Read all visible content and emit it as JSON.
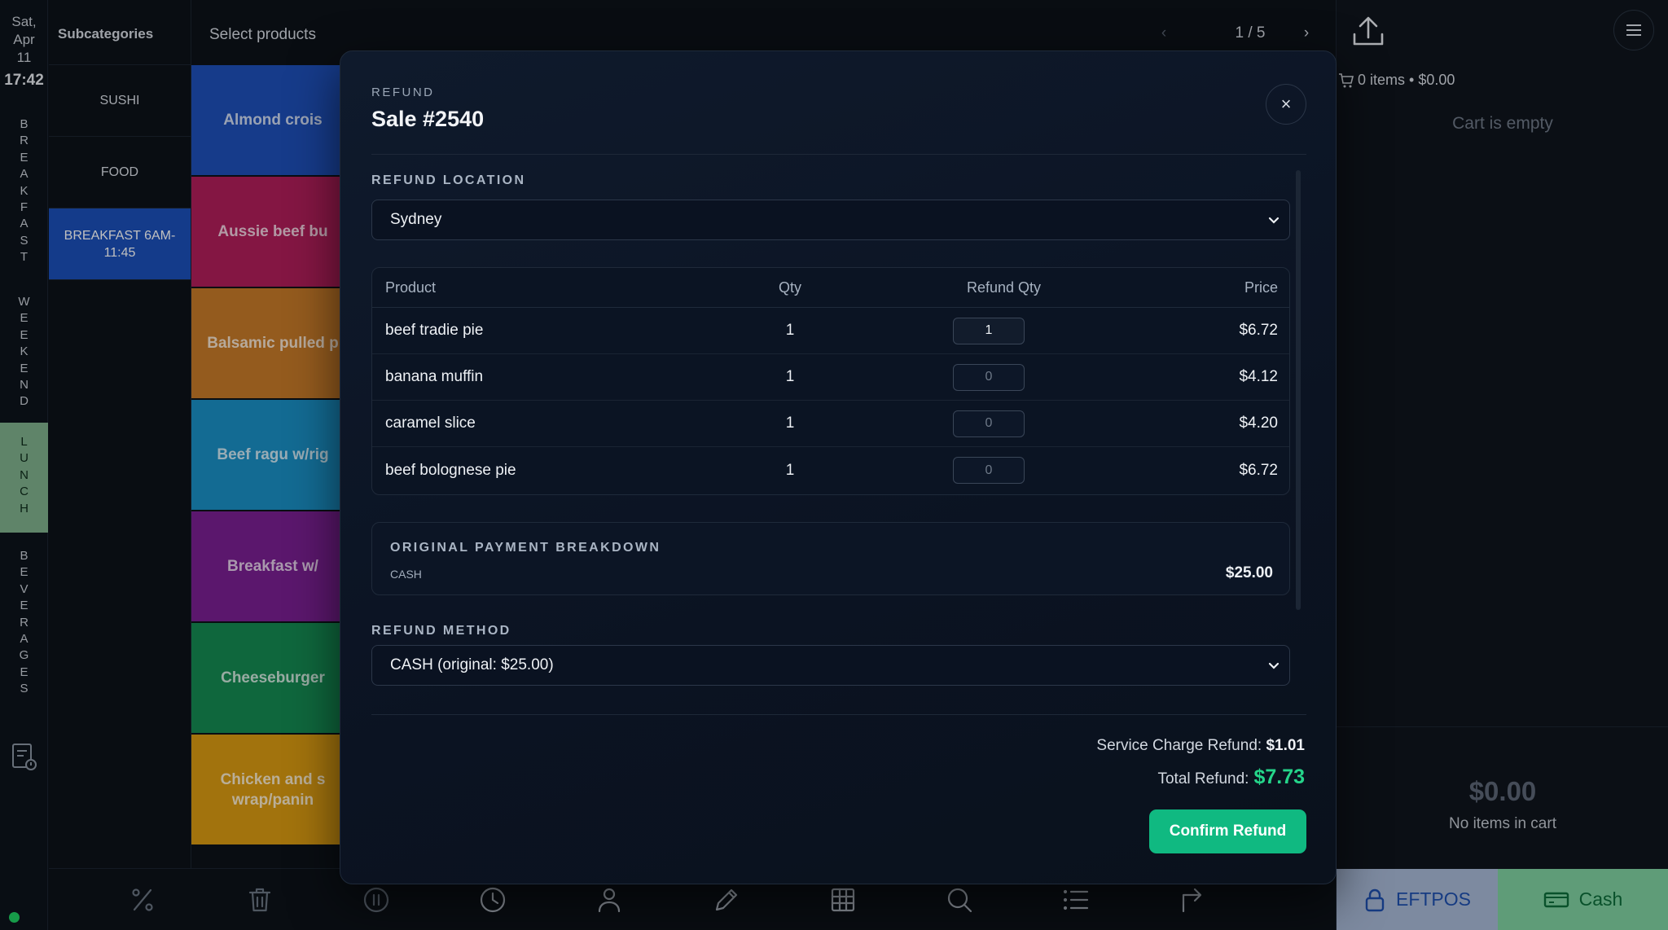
{
  "clock": {
    "date": "Sat,\nApr\n11",
    "time": "17:42"
  },
  "categories": [
    {
      "label": "BREAKFAST",
      "active": false
    },
    {
      "label": "WEEKEND",
      "active": false
    },
    {
      "label": "LUNCH",
      "active": true
    },
    {
      "label": "BEVERAGES",
      "active": false
    }
  ],
  "subcategories": {
    "title": "Subcategories",
    "items": [
      {
        "label": "SUSHI",
        "active": false
      },
      {
        "label": "FOOD",
        "active": false
      },
      {
        "label": "BREAKFAST 6AM-11:45",
        "active": true
      }
    ]
  },
  "products": {
    "title": "Select products",
    "pager": {
      "prev": "‹",
      "page": "1 / 5",
      "next": "›"
    },
    "tiles": [
      {
        "label": "Almond crois",
        "color": "#1e4fb8"
      },
      {
        "label": "Aussie beef bu",
        "color": "#b01e5a"
      },
      {
        "label": "Balsamic pulled p",
        "color": "#c67a28"
      },
      {
        "label": "Beef ragu w/rig",
        "color": "#1a8fc4"
      },
      {
        "label": "Breakfast w/",
        "color": "#7a1f92"
      },
      {
        "label": "Cheeseburger",
        "color": "#148a52"
      },
      {
        "label": "Chicken and s wrap/panin",
        "color": "#d99a12"
      }
    ]
  },
  "cart": {
    "summary": "0 items • $0.00",
    "empty_text": "Cart is empty",
    "total": "$0.00",
    "no_items": "No items in cart",
    "eftpos_label": "EFTPOS",
    "cash_label": "Cash"
  },
  "modal": {
    "kicker": "REFUND",
    "title": "Sale #2540",
    "close": "×",
    "location_label": "REFUND LOCATION",
    "location_value": "Sydney",
    "table": {
      "headers": {
        "product": "Product",
        "qty": "Qty",
        "refund_qty": "Refund Qty",
        "price": "Price"
      },
      "rows": [
        {
          "product": "beef tradie pie",
          "qty": "1",
          "refund_qty": "1",
          "price": "$6.72"
        },
        {
          "product": "banana muffin",
          "qty": "1",
          "refund_qty": "0",
          "price": "$4.12"
        },
        {
          "product": "caramel slice",
          "qty": "1",
          "refund_qty": "0",
          "price": "$4.20"
        },
        {
          "product": "beef bolognese pie",
          "qty": "1",
          "refund_qty": "0",
          "price": "$6.72"
        }
      ]
    },
    "payment": {
      "title": "ORIGINAL PAYMENT BREAKDOWN",
      "method": "CASH",
      "amount": "$25.00"
    },
    "method_label": "REFUND METHOD",
    "method_value": "CASH (original: $25.00)",
    "service_charge_label": "Service Charge Refund:",
    "service_charge_value": "$1.01",
    "total_label": "Total Refund:",
    "total_value": "$7.73",
    "confirm_label": "Confirm Refund"
  },
  "colors": {
    "accent": "#10b981",
    "total_green": "#25d58a",
    "active_category": "#7fb08c",
    "active_subcategory": "#1b4fb8"
  }
}
